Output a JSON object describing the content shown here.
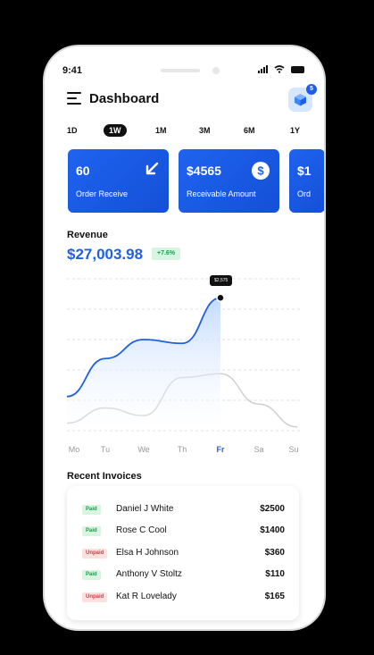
{
  "status_bar": {
    "time": "9:41"
  },
  "header": {
    "title": "Dashboard",
    "notification_count": "5"
  },
  "periods": [
    "1D",
    "1W",
    "1M",
    "3M",
    "6M",
    "1Y"
  ],
  "active_period": "1W",
  "cards": [
    {
      "value": "60",
      "label": "Order Receive",
      "icon": "arrow-down-left-icon"
    },
    {
      "value": "$4565",
      "label": "Receivable Amount",
      "icon": "dollar-icon"
    },
    {
      "value": "$1",
      "label": "Ord",
      "icon": "none"
    }
  ],
  "revenue": {
    "label": "Revenue",
    "value": "$27,003.98",
    "change": "+7.6%",
    "tooltip": "$2,575"
  },
  "chart_data": {
    "type": "line",
    "categories": [
      "Mo",
      "Tu",
      "We",
      "Th",
      "Fr",
      "Sa",
      "Su"
    ],
    "active_category": "Fr",
    "grid": true,
    "series": [
      {
        "values": [
          18,
          38,
          48,
          46,
          70
        ],
        "color": "#1f5fe0",
        "filled": true
      },
      {
        "values": [
          4,
          12,
          8,
          28,
          30,
          14,
          2
        ],
        "color": "#cfcfcf",
        "filled": false
      }
    ],
    "ylim": [
      0,
      80
    ]
  },
  "recent_invoices": {
    "title": "Recent Invoices",
    "rows": [
      {
        "status": "Paid",
        "name": "Daniel J White",
        "amount": "$2500"
      },
      {
        "status": "Paid",
        "name": "Rose C Cool",
        "amount": "$1400"
      },
      {
        "status": "Unpaid",
        "name": "Elsa H Johnson",
        "amount": "$360"
      },
      {
        "status": "Paid",
        "name": "Anthony V Stoltz",
        "amount": "$110"
      },
      {
        "status": "Unpaid",
        "name": "Kat R Lovelady",
        "amount": "$165"
      }
    ]
  },
  "colors": {
    "accent": "#1f5fe0",
    "paid": "#1a9a4a",
    "unpaid": "#d33c3c"
  }
}
